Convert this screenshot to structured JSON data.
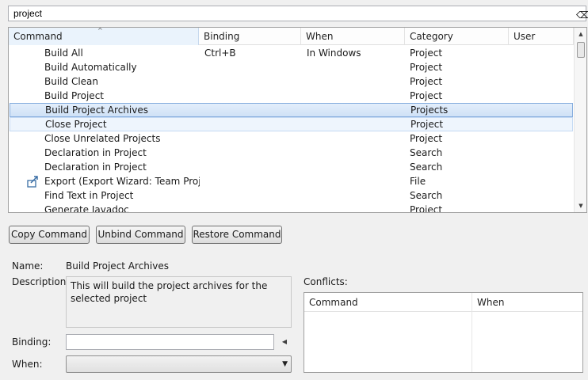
{
  "filter": {
    "value": "project"
  },
  "commands_table": {
    "columns": [
      "Command",
      "Binding",
      "When",
      "Category",
      "User"
    ],
    "sort_indicator": "^",
    "rows": [
      {
        "command": "Build All",
        "binding": "Ctrl+B",
        "when": "In Windows",
        "category": "Project",
        "user": ""
      },
      {
        "command": "Build Automatically",
        "binding": "",
        "when": "",
        "category": "Project",
        "user": ""
      },
      {
        "command": "Build Clean",
        "binding": "",
        "when": "",
        "category": "Project",
        "user": ""
      },
      {
        "command": "Build Project",
        "binding": "",
        "when": "",
        "category": "Project",
        "user": ""
      },
      {
        "command": "Build Project Archives",
        "binding": "",
        "when": "",
        "category": "Projects",
        "user": "",
        "state": "selected"
      },
      {
        "command": "Close Project",
        "binding": "",
        "when": "",
        "category": "Project",
        "user": "",
        "state": "hover"
      },
      {
        "command": "Close Unrelated Projects",
        "binding": "",
        "when": "",
        "category": "Project",
        "user": ""
      },
      {
        "command": "Declaration in Project",
        "binding": "",
        "when": "",
        "category": "Search",
        "user": ""
      },
      {
        "command": "Declaration in Project",
        "binding": "",
        "when": "",
        "category": "Search",
        "user": ""
      },
      {
        "command": "Export (Export Wizard: Team Project S",
        "binding": "",
        "when": "",
        "category": "File",
        "user": "",
        "icon": "export-icon"
      },
      {
        "command": "Find Text in Project",
        "binding": "",
        "when": "",
        "category": "Search",
        "user": ""
      },
      {
        "command": "Generate Javadoc",
        "binding": "",
        "when": "",
        "category": "Project",
        "user": ""
      }
    ]
  },
  "buttons": {
    "copy": "Copy Command",
    "unbind": "Unbind Command",
    "restore": "Restore Command"
  },
  "details": {
    "name_label": "Name:",
    "name_value": "Build Project Archives",
    "description_label": "Description:",
    "description_value": "This will build the project archives for the selected project",
    "binding_label": "Binding:",
    "binding_value": "",
    "when_label": "When:",
    "when_value": ""
  },
  "conflicts": {
    "label": "Conflicts:",
    "columns": [
      "Command",
      "When"
    ]
  },
  "colors": {
    "selection_fill": "#cfe1f6",
    "selection_border": "#84acdd",
    "window_bg": "#f0f0f0"
  }
}
